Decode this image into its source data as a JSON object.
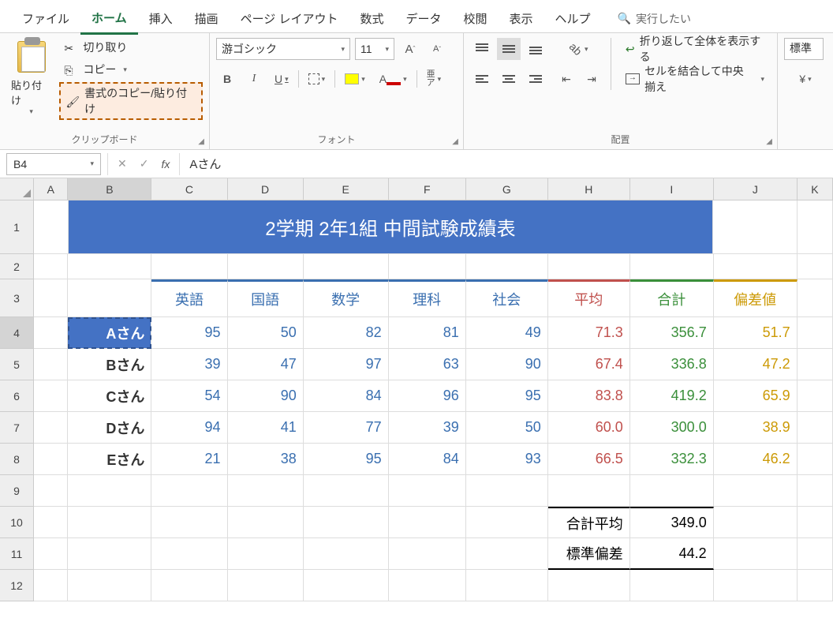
{
  "tabs": {
    "file": "ファイル",
    "home": "ホーム",
    "insert": "挿入",
    "draw": "描画",
    "pageLayout": "ページ レイアウト",
    "formulas": "数式",
    "data": "データ",
    "review": "校閲",
    "view": "表示",
    "help": "ヘルプ",
    "tellMe": "実行したい"
  },
  "ribbon": {
    "clipboard": {
      "paste": "貼り付け",
      "cut": "切り取り",
      "copy": "コピー",
      "formatPainter": "書式のコピー/貼り付け",
      "label": "クリップボード"
    },
    "font": {
      "name": "游ゴシック",
      "size": "11",
      "label": "フォント",
      "bold": "B",
      "italic": "I",
      "underline": "U",
      "grow": "A",
      "shrink": "A",
      "colorA": "A",
      "rubyTop": "亜",
      "rubyBot": "ア"
    },
    "alignment": {
      "wrap": "折り返して全体を表示する",
      "merge": "セルを結合して中央揃え",
      "label": "配置",
      "orient": "ab"
    },
    "number": {
      "general": "標準"
    }
  },
  "fbar": {
    "cell": "B4",
    "value": "Aさん",
    "fx": "fx"
  },
  "cols": [
    "A",
    "B",
    "C",
    "D",
    "E",
    "F",
    "G",
    "H",
    "I",
    "J",
    "K"
  ],
  "rows": [
    "1",
    "2",
    "3",
    "4",
    "5",
    "6",
    "7",
    "8",
    "9",
    "10",
    "11",
    "12"
  ],
  "title": "2学期 2年1組 中間試験成績表",
  "headers": {
    "eng": "英語",
    "jpn": "国語",
    "mth": "数学",
    "sci": "理科",
    "soc": "社会",
    "avg": "平均",
    "sum": "合計",
    "dev": "偏差値"
  },
  "students": [
    {
      "name": "Aさん",
      "eng": "95",
      "jpn": "50",
      "mth": "82",
      "sci": "81",
      "soc": "49",
      "avg": "71.3",
      "sum": "356.7",
      "dev": "51.7"
    },
    {
      "name": "Bさん",
      "eng": "39",
      "jpn": "47",
      "mth": "97",
      "sci": "63",
      "soc": "90",
      "avg": "67.4",
      "sum": "336.8",
      "dev": "47.2"
    },
    {
      "name": "Cさん",
      "eng": "54",
      "jpn": "90",
      "mth": "84",
      "sci": "96",
      "soc": "95",
      "avg": "83.8",
      "sum": "419.2",
      "dev": "65.9"
    },
    {
      "name": "Dさん",
      "eng": "94",
      "jpn": "41",
      "mth": "77",
      "sci": "39",
      "soc": "50",
      "avg": "60.0",
      "sum": "300.0",
      "dev": "38.9"
    },
    {
      "name": "Eさん",
      "eng": "21",
      "jpn": "38",
      "mth": "95",
      "sci": "84",
      "soc": "93",
      "avg": "66.5",
      "sum": "332.3",
      "dev": "46.2"
    }
  ],
  "summary": {
    "avgLabel": "合計平均",
    "avgVal": "349.0",
    "stdLabel": "標準偏差",
    "stdVal": "44.2"
  }
}
